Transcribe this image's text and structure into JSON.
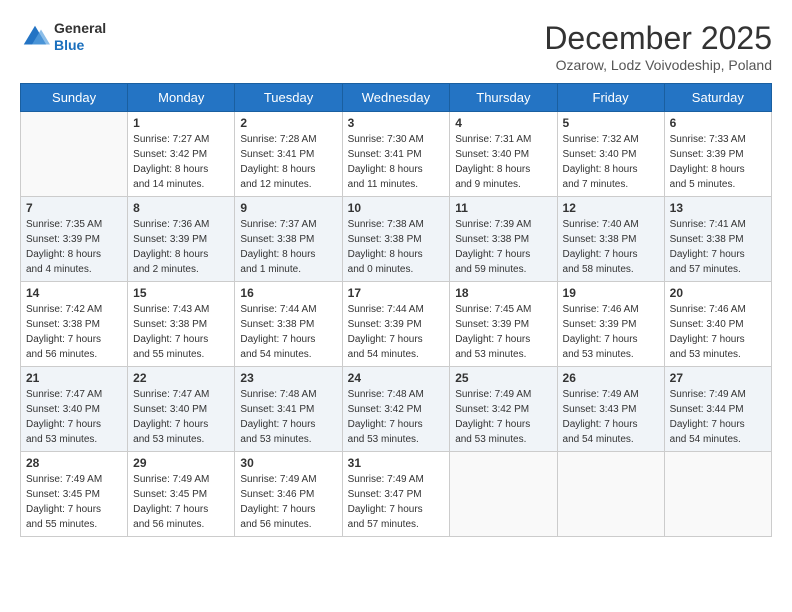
{
  "header": {
    "logo": {
      "general": "General",
      "blue": "Blue"
    },
    "title": "December 2025",
    "location": "Ozarow, Lodz Voivodeship, Poland"
  },
  "calendar": {
    "days_of_week": [
      "Sunday",
      "Monday",
      "Tuesday",
      "Wednesday",
      "Thursday",
      "Friday",
      "Saturday"
    ],
    "weeks": [
      [
        {
          "day": "",
          "info": ""
        },
        {
          "day": "1",
          "info": "Sunrise: 7:27 AM\nSunset: 3:42 PM\nDaylight: 8 hours\nand 14 minutes."
        },
        {
          "day": "2",
          "info": "Sunrise: 7:28 AM\nSunset: 3:41 PM\nDaylight: 8 hours\nand 12 minutes."
        },
        {
          "day": "3",
          "info": "Sunrise: 7:30 AM\nSunset: 3:41 PM\nDaylight: 8 hours\nand 11 minutes."
        },
        {
          "day": "4",
          "info": "Sunrise: 7:31 AM\nSunset: 3:40 PM\nDaylight: 8 hours\nand 9 minutes."
        },
        {
          "day": "5",
          "info": "Sunrise: 7:32 AM\nSunset: 3:40 PM\nDaylight: 8 hours\nand 7 minutes."
        },
        {
          "day": "6",
          "info": "Sunrise: 7:33 AM\nSunset: 3:39 PM\nDaylight: 8 hours\nand 5 minutes."
        }
      ],
      [
        {
          "day": "7",
          "info": "Sunrise: 7:35 AM\nSunset: 3:39 PM\nDaylight: 8 hours\nand 4 minutes."
        },
        {
          "day": "8",
          "info": "Sunrise: 7:36 AM\nSunset: 3:39 PM\nDaylight: 8 hours\nand 2 minutes."
        },
        {
          "day": "9",
          "info": "Sunrise: 7:37 AM\nSunset: 3:38 PM\nDaylight: 8 hours\nand 1 minute."
        },
        {
          "day": "10",
          "info": "Sunrise: 7:38 AM\nSunset: 3:38 PM\nDaylight: 8 hours\nand 0 minutes."
        },
        {
          "day": "11",
          "info": "Sunrise: 7:39 AM\nSunset: 3:38 PM\nDaylight: 7 hours\nand 59 minutes."
        },
        {
          "day": "12",
          "info": "Sunrise: 7:40 AM\nSunset: 3:38 PM\nDaylight: 7 hours\nand 58 minutes."
        },
        {
          "day": "13",
          "info": "Sunrise: 7:41 AM\nSunset: 3:38 PM\nDaylight: 7 hours\nand 57 minutes."
        }
      ],
      [
        {
          "day": "14",
          "info": "Sunrise: 7:42 AM\nSunset: 3:38 PM\nDaylight: 7 hours\nand 56 minutes."
        },
        {
          "day": "15",
          "info": "Sunrise: 7:43 AM\nSunset: 3:38 PM\nDaylight: 7 hours\nand 55 minutes."
        },
        {
          "day": "16",
          "info": "Sunrise: 7:44 AM\nSunset: 3:38 PM\nDaylight: 7 hours\nand 54 minutes."
        },
        {
          "day": "17",
          "info": "Sunrise: 7:44 AM\nSunset: 3:39 PM\nDaylight: 7 hours\nand 54 minutes."
        },
        {
          "day": "18",
          "info": "Sunrise: 7:45 AM\nSunset: 3:39 PM\nDaylight: 7 hours\nand 53 minutes."
        },
        {
          "day": "19",
          "info": "Sunrise: 7:46 AM\nSunset: 3:39 PM\nDaylight: 7 hours\nand 53 minutes."
        },
        {
          "day": "20",
          "info": "Sunrise: 7:46 AM\nSunset: 3:40 PM\nDaylight: 7 hours\nand 53 minutes."
        }
      ],
      [
        {
          "day": "21",
          "info": "Sunrise: 7:47 AM\nSunset: 3:40 PM\nDaylight: 7 hours\nand 53 minutes."
        },
        {
          "day": "22",
          "info": "Sunrise: 7:47 AM\nSunset: 3:40 PM\nDaylight: 7 hours\nand 53 minutes."
        },
        {
          "day": "23",
          "info": "Sunrise: 7:48 AM\nSunset: 3:41 PM\nDaylight: 7 hours\nand 53 minutes."
        },
        {
          "day": "24",
          "info": "Sunrise: 7:48 AM\nSunset: 3:42 PM\nDaylight: 7 hours\nand 53 minutes."
        },
        {
          "day": "25",
          "info": "Sunrise: 7:49 AM\nSunset: 3:42 PM\nDaylight: 7 hours\nand 53 minutes."
        },
        {
          "day": "26",
          "info": "Sunrise: 7:49 AM\nSunset: 3:43 PM\nDaylight: 7 hours\nand 54 minutes."
        },
        {
          "day": "27",
          "info": "Sunrise: 7:49 AM\nSunset: 3:44 PM\nDaylight: 7 hours\nand 54 minutes."
        }
      ],
      [
        {
          "day": "28",
          "info": "Sunrise: 7:49 AM\nSunset: 3:45 PM\nDaylight: 7 hours\nand 55 minutes."
        },
        {
          "day": "29",
          "info": "Sunrise: 7:49 AM\nSunset: 3:45 PM\nDaylight: 7 hours\nand 56 minutes."
        },
        {
          "day": "30",
          "info": "Sunrise: 7:49 AM\nSunset: 3:46 PM\nDaylight: 7 hours\nand 56 minutes."
        },
        {
          "day": "31",
          "info": "Sunrise: 7:49 AM\nSunset: 3:47 PM\nDaylight: 7 hours\nand 57 minutes."
        },
        {
          "day": "",
          "info": ""
        },
        {
          "day": "",
          "info": ""
        },
        {
          "day": "",
          "info": ""
        }
      ]
    ]
  }
}
